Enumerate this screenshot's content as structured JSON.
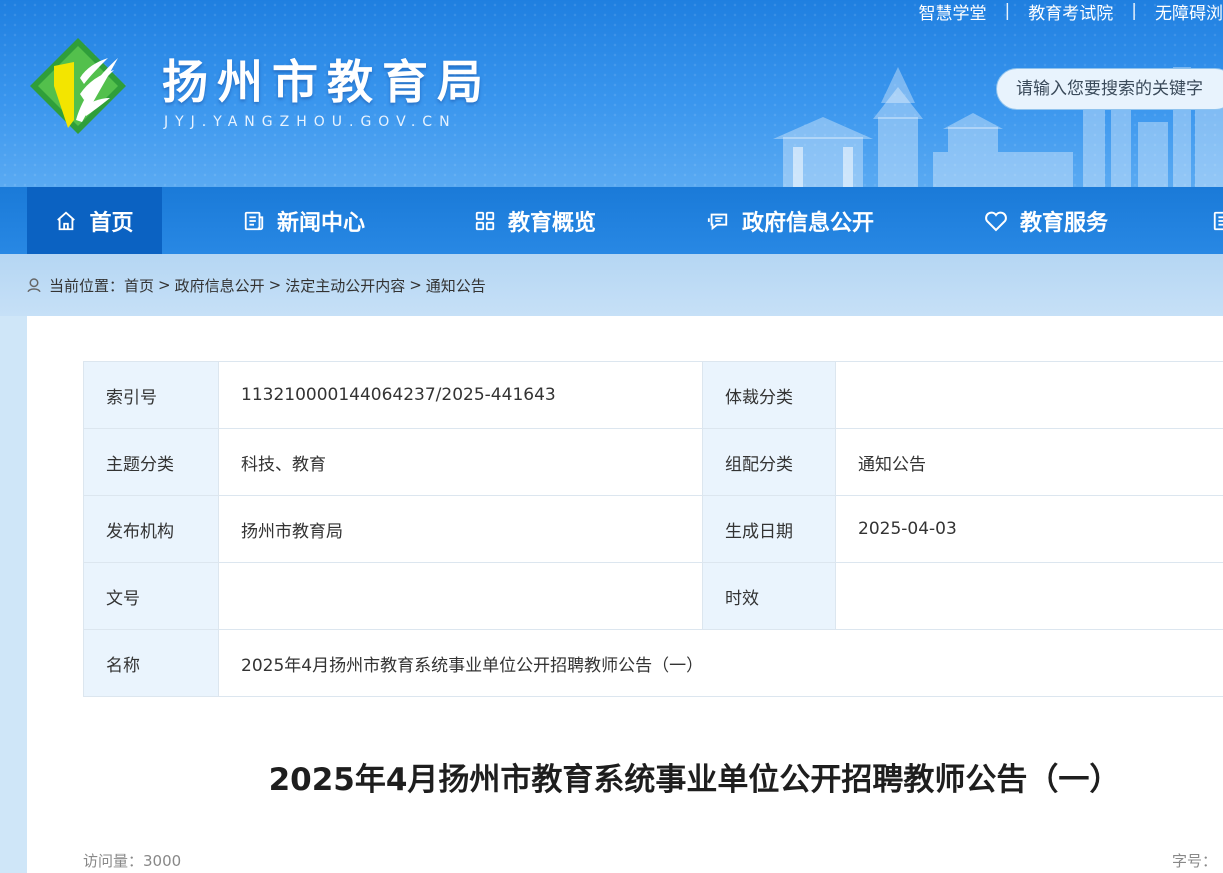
{
  "top_links": [
    "智慧学堂",
    "教育考试院",
    "无障碍浏"
  ],
  "site": {
    "title": "扬州市教育局",
    "domain": "JYJ.YANGZHOU.GOV.CN"
  },
  "search": {
    "placeholder": "请输入您要搜索的关键字"
  },
  "nav": [
    {
      "label": "首页",
      "icon": "home-icon"
    },
    {
      "label": "新闻中心",
      "icon": "news-icon"
    },
    {
      "label": "教育概览",
      "icon": "grid-icon"
    },
    {
      "label": "政府信息公开",
      "icon": "chat-icon"
    },
    {
      "label": "教育服务",
      "icon": "heart-icon"
    }
  ],
  "breadcrumb": {
    "prefix": "当前位置：",
    "items": [
      "首页",
      "政府信息公开",
      "法定主动公开内容",
      "通知公告"
    ]
  },
  "meta_table": {
    "index_no_label": "索引号",
    "index_no": "113210000144064237/2025-441643",
    "genre_label": "体裁分类",
    "genre": "",
    "topic_label": "主题分类",
    "topic": "科技、教育",
    "group_label": "组配分类",
    "group": "通知公告",
    "publisher_label": "发布机构",
    "publisher": "扬州市教育局",
    "date_label": "生成日期",
    "date": "2025-04-03",
    "doc_no_label": "文号",
    "doc_no": "",
    "validity_label": "时效",
    "validity": "",
    "name_label": "名称",
    "name": "2025年4月扬州市教育系统事业单位公开招聘教师公告（一）"
  },
  "article": {
    "title": "2025年4月扬州市教育系统事业单位公开招聘教师公告（一）",
    "visits": "访问量：3000",
    "font_size_label": "字号："
  },
  "colors": {
    "header_blue": "#2a8ae8",
    "nav_active": "#0b62c2",
    "label_bg": "#eaf4fd"
  }
}
